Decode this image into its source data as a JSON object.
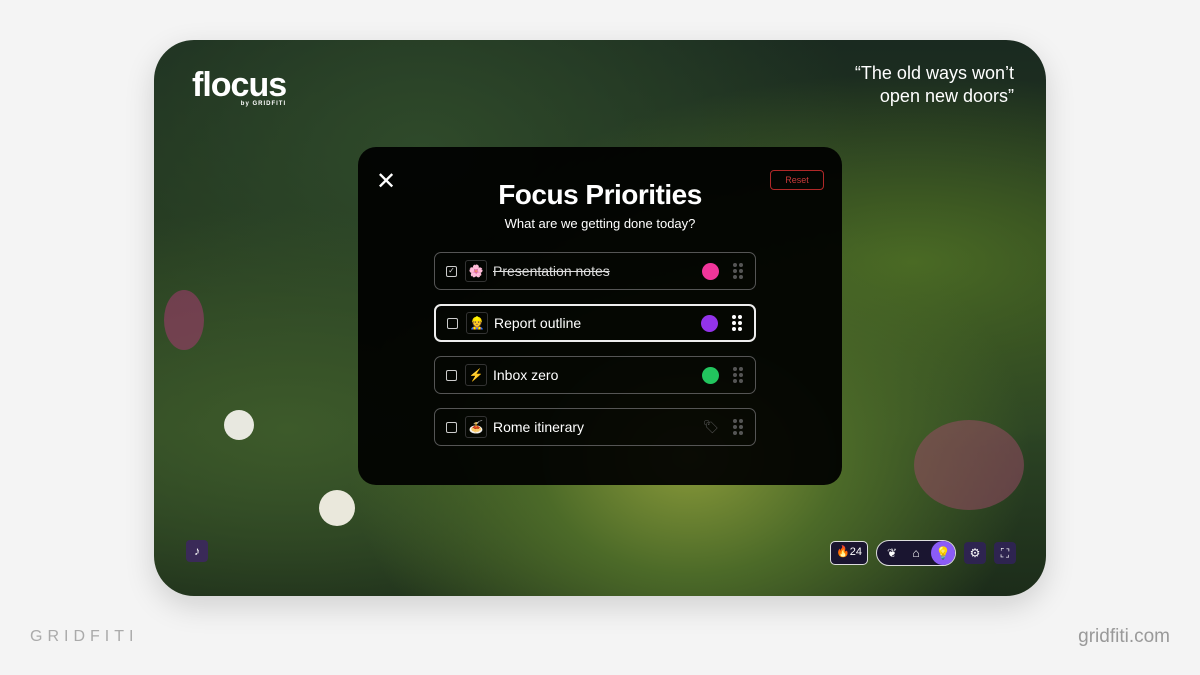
{
  "app": {
    "logo": "flocus",
    "logo_sub": "by GRIDFITI",
    "quote": "“The old ways won’t open new doors”"
  },
  "modal": {
    "close_icon": "close-icon",
    "reset_label": "Reset",
    "title": "Focus Priorities",
    "subtitle": "What are we getting done today?",
    "tasks": [
      {
        "label": "Presentation notes",
        "emoji": "🌸",
        "checked": true,
        "color": "#f0359a"
      },
      {
        "label": "Report outline",
        "emoji": "👷",
        "checked": false,
        "color": "#9333ea"
      },
      {
        "label": "Inbox zero",
        "emoji": "⚡",
        "checked": false,
        "color": "#22c55e"
      },
      {
        "label": "Rome itinerary",
        "emoji": "🍝",
        "checked": false,
        "color": null
      }
    ]
  },
  "bottom": {
    "music_icon": "♪",
    "streak_icon": "🔥",
    "streak": "24",
    "settings_icon": "⚙",
    "fullscreen_icon": "⛶"
  },
  "watermark": {
    "left": "GRIDFITI",
    "right": "gridfiti.com"
  }
}
